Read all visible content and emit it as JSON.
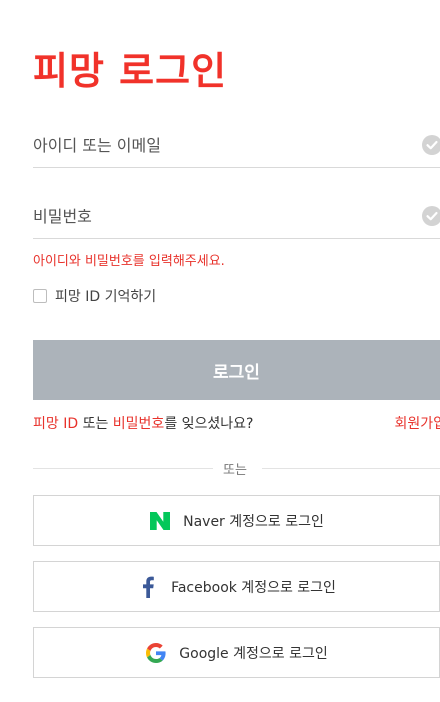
{
  "title": "피망 로그인",
  "id_field": {
    "placeholder": "아이디 또는 이메일"
  },
  "password_field": {
    "placeholder": "비밀번호"
  },
  "error_message": "아이디와 비밀번호를 입력해주세요.",
  "remember": {
    "label": "피망 ID 기억하기",
    "checked": false
  },
  "login_button": "로그인",
  "links": {
    "forgot_id": "피망 ID",
    "forgot_or": " 또는 ",
    "forgot_pw": "비밀번호",
    "forgot_suffix": "를 잊으셨나요?",
    "signup": "회원가입"
  },
  "divider_text": "또는",
  "social": {
    "naver": "Naver 계정으로 로그인",
    "facebook": "Facebook 계정으로 로그인",
    "google": "Google 계정으로 로그인"
  },
  "colors": {
    "brand_red": "#f1322a",
    "button_disabled": "#acb3ba",
    "naver_green": "#03c75a",
    "facebook_blue": "#3b5998"
  },
  "icons": {
    "check": "check-circle-icon",
    "naver": "naver-logo-icon",
    "facebook": "facebook-logo-icon",
    "google": "google-logo-icon"
  }
}
